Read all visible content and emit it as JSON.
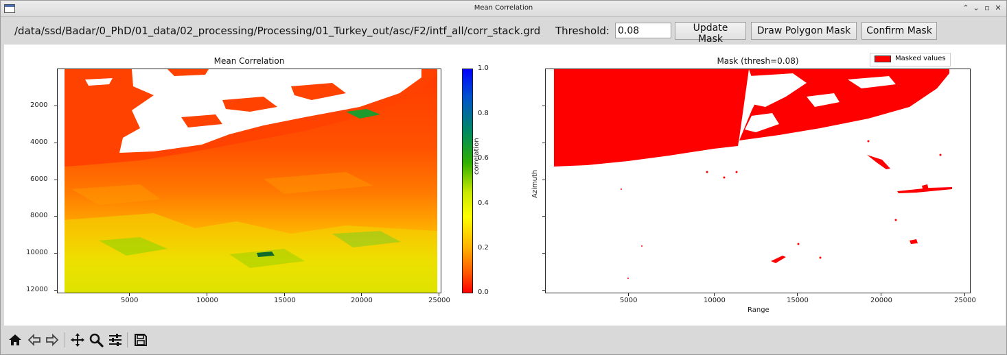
{
  "window": {
    "title": "Mean Correlation"
  },
  "controls": {
    "file_path": "/data/ssd/Badar/0_PhD/01_data/02_processing/Processing/01_Turkey_out/asc/F2/intf_all/corr_stack.grd",
    "threshold_label": "Threshold:",
    "threshold_value": "0.08",
    "update_label": "Update Mask",
    "draw_label": "Draw Polygon Mask",
    "confirm_label": "Confirm Mask"
  },
  "left_plot": {
    "title": "Mean Correlation",
    "x_ticks": [
      "5000",
      "10000",
      "15000",
      "20000",
      "25000"
    ],
    "y_ticks": [
      "2000",
      "4000",
      "6000",
      "8000",
      "10000",
      "12000"
    ],
    "colorbar": {
      "label": "correlation",
      "ticks": [
        "0.0",
        "0.2",
        "0.4",
        "0.6",
        "0.8",
        "1.0"
      ]
    }
  },
  "right_plot": {
    "title": "Mask (thresh=0.08)",
    "legend_label": "Masked values",
    "xlabel": "Range",
    "ylabel": "Azimuth",
    "x_ticks": [
      "5000",
      "10000",
      "15000",
      "20000",
      "25000"
    ]
  },
  "chart_data": [
    {
      "type": "heatmap",
      "title": "Mean Correlation",
      "xlabel": "",
      "ylabel": "",
      "xlim": [
        0,
        25500
      ],
      "ylim": [
        12200,
        0
      ],
      "x_ticks": [
        5000,
        10000,
        15000,
        20000,
        25000
      ],
      "y_ticks": [
        2000,
        4000,
        6000,
        8000,
        10000,
        12000
      ],
      "colorbar": {
        "label": "correlation",
        "range": [
          0.0,
          1.0
        ],
        "colormap": "red-yellow-green-blue"
      }
    },
    {
      "type": "heatmap",
      "title": "Mask (thresh=0.08)",
      "xlabel": "Range",
      "ylabel": "Azimuth",
      "threshold": 0.08,
      "legend": [
        "Masked values"
      ],
      "xlim": [
        0,
        25500
      ],
      "x_ticks": [
        5000,
        10000,
        15000,
        20000,
        25000
      ]
    }
  ],
  "colors": {
    "masked": "#ff0000",
    "low_corr": "#ff4a00",
    "mid_corr": "#f0ff00"
  },
  "toolbar": {
    "icons": [
      "home-icon",
      "back-icon",
      "forward-icon",
      "pan-icon",
      "zoom-icon",
      "configure-icon",
      "save-icon"
    ]
  }
}
